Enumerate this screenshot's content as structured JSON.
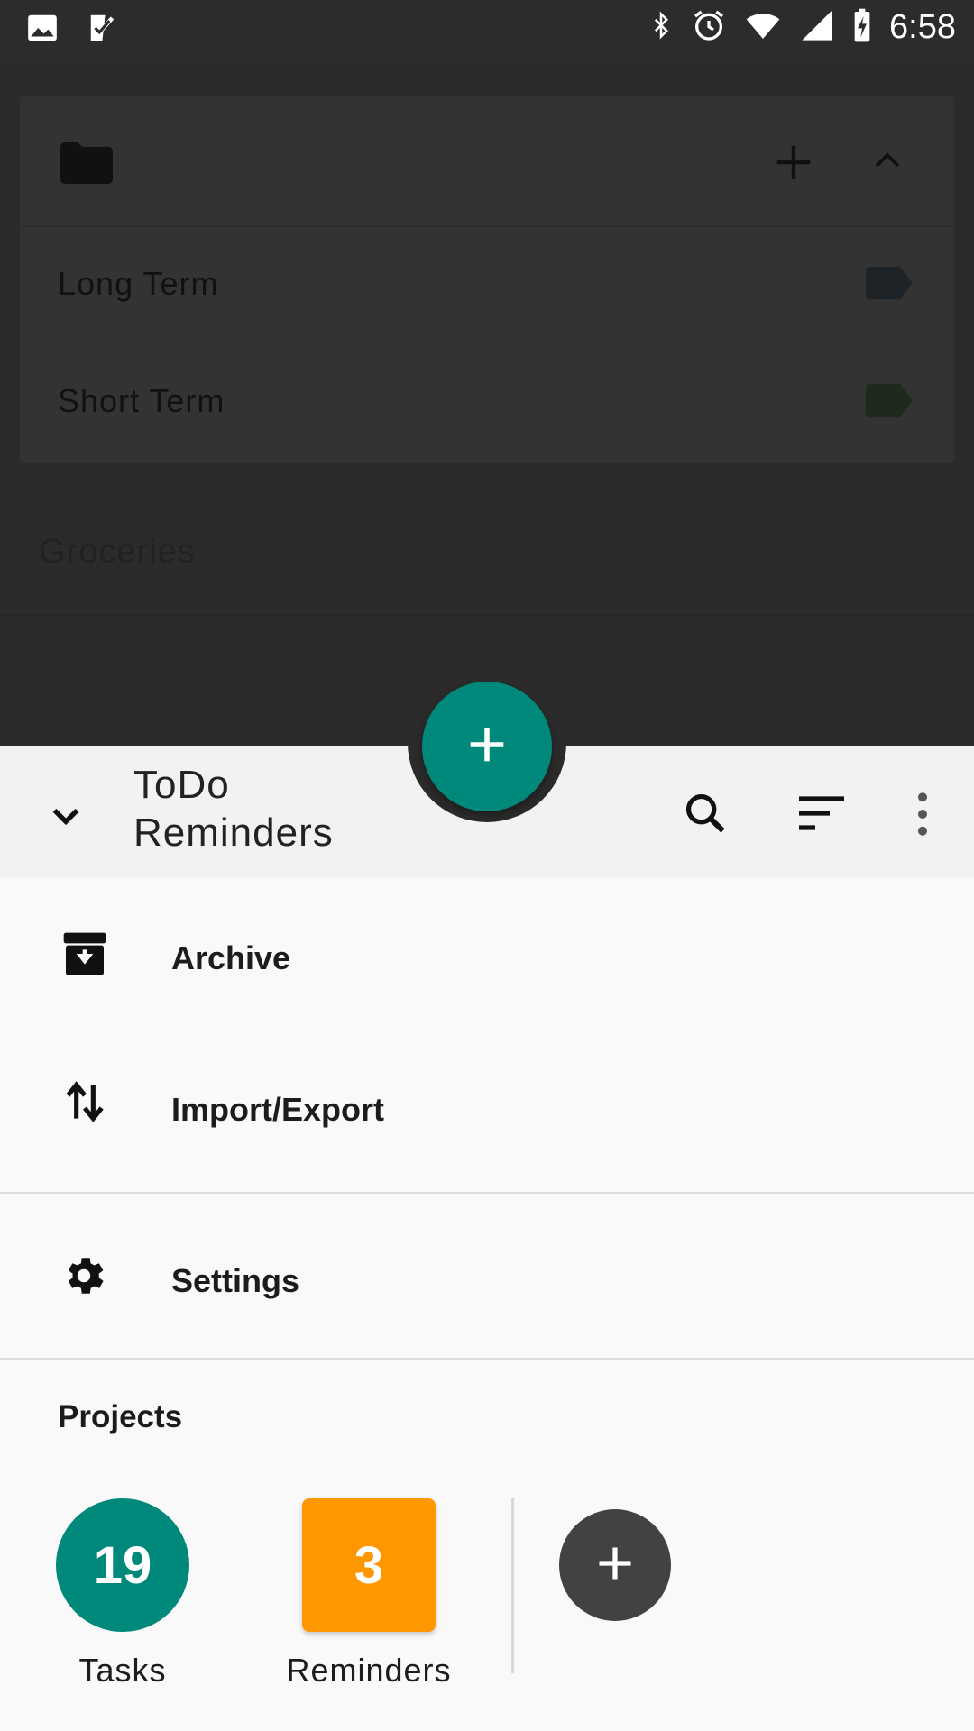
{
  "status_bar": {
    "time": "6:58",
    "left_icons": [
      "image-icon",
      "check-app-icon"
    ],
    "right_icons": [
      "bluetooth-icon",
      "alarm-icon",
      "wifi-icon",
      "signal-icon",
      "battery-charging-icon"
    ]
  },
  "background": {
    "card": {
      "folder_icon": "folder-icon",
      "rows": [
        {
          "label": "Long Term",
          "tag_color": "#1e2327"
        },
        {
          "label": "Short Term",
          "tag_color": "#1e2a1e"
        }
      ]
    },
    "next_item": "Groceries"
  },
  "sheet": {
    "title_line1": "ToDo",
    "title_line2": "Reminders",
    "menu": [
      {
        "label": "Archive",
        "icon": "archive-icon"
      },
      {
        "label": "Import/Export",
        "icon": "import-export-icon"
      },
      {
        "label": "Settings",
        "icon": "gear-icon"
      }
    ],
    "projects_label": "Projects",
    "projects": [
      {
        "name": "Tasks",
        "count": "19",
        "shape": "circle",
        "color": "#00897b"
      },
      {
        "name": "Reminders",
        "count": "3",
        "shape": "square",
        "color": "#ff9800"
      }
    ]
  },
  "colors": {
    "accent": "#00897b",
    "orange": "#ff9800",
    "dark_button": "#424242"
  }
}
